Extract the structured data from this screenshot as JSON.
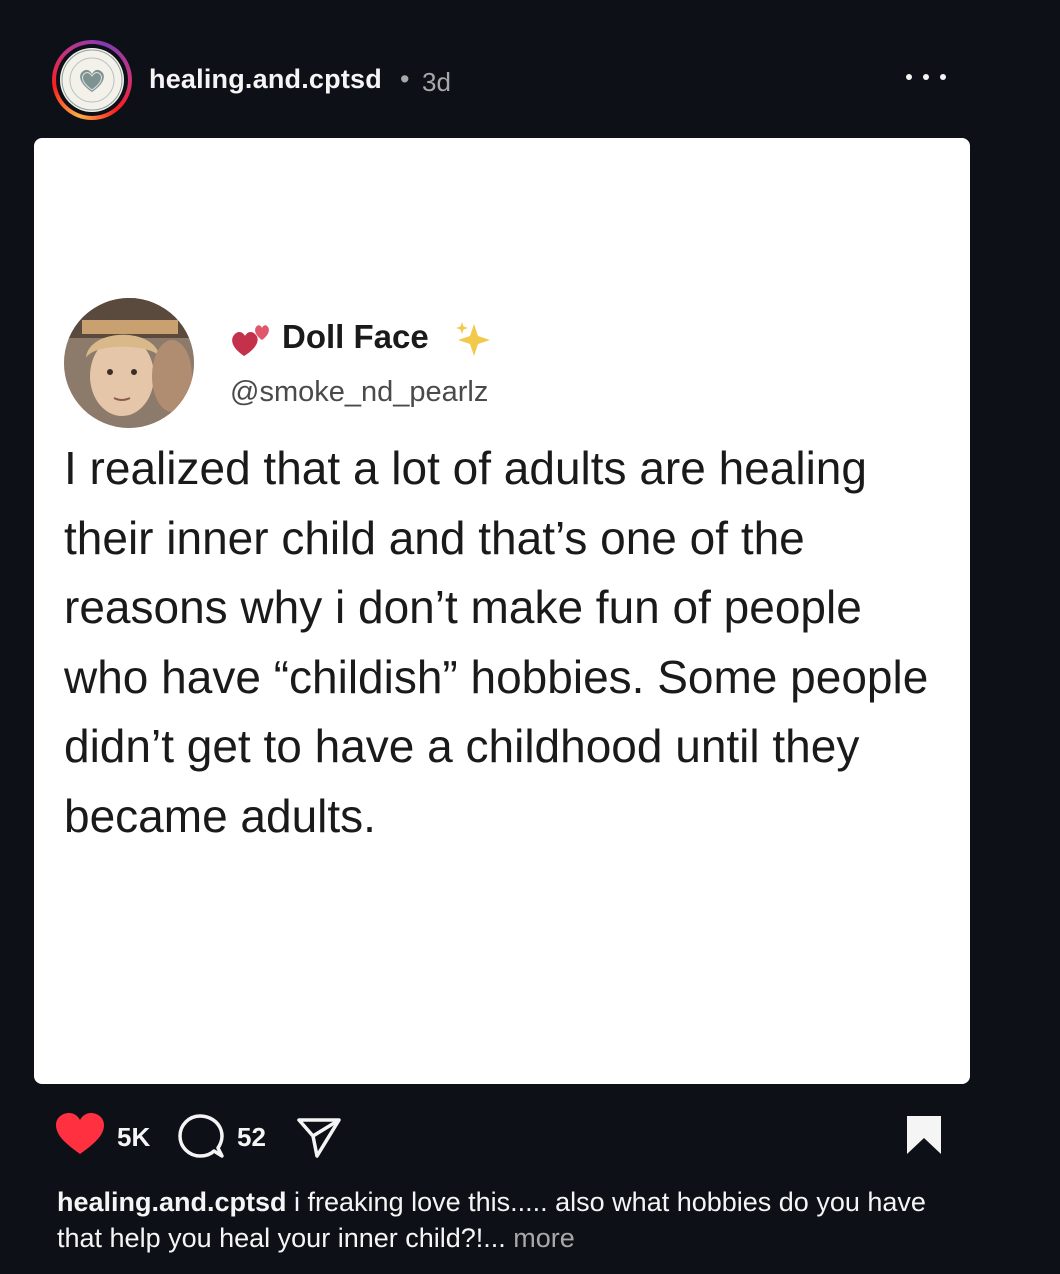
{
  "header": {
    "username": "healing.and.cptsd",
    "separator": "•",
    "time": "3d"
  },
  "tweet": {
    "display_name": "Doll Face",
    "handle": "@smoke_nd_pearlz",
    "body": "I realized that a lot of adults are healing their inner child and that’s one of the reasons why i don’t make fun of people who have “childish” hobbies. Some people didn’t get to have a childhood until they became adults.",
    "heart_emoji": "💕",
    "sparkle_emoji": "✨"
  },
  "actions": {
    "like_count": "5K",
    "comment_count": "52"
  },
  "caption": {
    "username": "healing.and.cptsd",
    "text": " i freaking love this..... also what hobbies do you have that help you heal your inner child?!...",
    "more_label": " more"
  },
  "colors": {
    "background": "#0d1117",
    "like_red": "#ff3040",
    "muted_text": "#a8a8a8"
  }
}
